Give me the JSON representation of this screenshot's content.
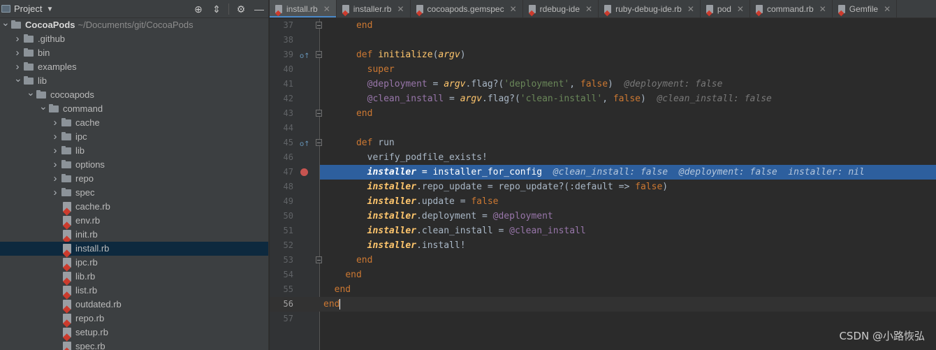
{
  "project_panel": {
    "title": "Project",
    "tree": [
      {
        "name": "CocoaPods",
        "path": "~/Documents/git/CocoaPods",
        "kind": "root",
        "expanded": true,
        "depth": 0
      },
      {
        "name": ".github",
        "kind": "folder",
        "expanded": false,
        "depth": 1
      },
      {
        "name": "bin",
        "kind": "folder",
        "expanded": false,
        "depth": 1
      },
      {
        "name": "examples",
        "kind": "folder",
        "expanded": false,
        "depth": 1
      },
      {
        "name": "lib",
        "kind": "folder",
        "expanded": true,
        "depth": 1
      },
      {
        "name": "cocoapods",
        "kind": "folder",
        "expanded": true,
        "depth": 2
      },
      {
        "name": "command",
        "kind": "folder",
        "expanded": true,
        "depth": 3
      },
      {
        "name": "cache",
        "kind": "folder",
        "expanded": false,
        "depth": 4
      },
      {
        "name": "ipc",
        "kind": "folder",
        "expanded": false,
        "depth": 4
      },
      {
        "name": "lib",
        "kind": "folder",
        "expanded": false,
        "depth": 4
      },
      {
        "name": "options",
        "kind": "folder",
        "expanded": false,
        "depth": 4
      },
      {
        "name": "repo",
        "kind": "folder",
        "expanded": false,
        "depth": 4
      },
      {
        "name": "spec",
        "kind": "folder",
        "expanded": false,
        "depth": 4
      },
      {
        "name": "cache.rb",
        "kind": "ruby-file",
        "depth": 4
      },
      {
        "name": "env.rb",
        "kind": "ruby-file",
        "depth": 4
      },
      {
        "name": "init.rb",
        "kind": "ruby-file",
        "depth": 4
      },
      {
        "name": "install.rb",
        "kind": "ruby-file",
        "depth": 4,
        "selected": true
      },
      {
        "name": "ipc.rb",
        "kind": "ruby-file",
        "depth": 4
      },
      {
        "name": "lib.rb",
        "kind": "ruby-file",
        "depth": 4
      },
      {
        "name": "list.rb",
        "kind": "ruby-file",
        "depth": 4
      },
      {
        "name": "outdated.rb",
        "kind": "ruby-file",
        "depth": 4
      },
      {
        "name": "repo.rb",
        "kind": "ruby-file",
        "depth": 4
      },
      {
        "name": "setup.rb",
        "kind": "ruby-file",
        "depth": 4
      },
      {
        "name": "spec.rb",
        "kind": "ruby-file",
        "depth": 4
      }
    ]
  },
  "tabs": [
    {
      "label": "install.rb",
      "active": true,
      "icon": "ruby-file-icon"
    },
    {
      "label": "installer.rb",
      "active": false,
      "icon": "ruby-file-icon"
    },
    {
      "label": "cocoapods.gemspec",
      "active": false,
      "icon": "ruby-file-icon"
    },
    {
      "label": "rdebug-ide",
      "active": false,
      "icon": "ruby-file-icon"
    },
    {
      "label": "ruby-debug-ide.rb",
      "active": false,
      "icon": "ruby-file-icon"
    },
    {
      "label": "pod",
      "active": false,
      "icon": "ruby-file-icon"
    },
    {
      "label": "command.rb",
      "active": false,
      "icon": "ruby-file-icon"
    },
    {
      "label": "Gemfile",
      "active": false,
      "icon": "ruby-file-icon"
    }
  ],
  "editor": {
    "execution_line": 47,
    "current_line": 56,
    "breakpoint_lines": [
      47
    ],
    "override_marker_lines": [
      39,
      45
    ],
    "fold_marker_lines": [
      37,
      39,
      43,
      45,
      53
    ],
    "lines": [
      {
        "n": 37,
        "tokens": [
          {
            "t": "      "
          },
          {
            "t": "end",
            "c": "kw"
          }
        ]
      },
      {
        "n": 38,
        "tokens": []
      },
      {
        "n": 39,
        "tokens": [
          {
            "t": "      "
          },
          {
            "t": "def ",
            "c": "kw"
          },
          {
            "t": "initialize",
            "c": "fn"
          },
          {
            "t": "("
          },
          {
            "t": "argv",
            "c": "param"
          },
          {
            "t": ")"
          }
        ]
      },
      {
        "n": 40,
        "tokens": [
          {
            "t": "        "
          },
          {
            "t": "super",
            "c": "kw"
          }
        ]
      },
      {
        "n": 41,
        "tokens": [
          {
            "t": "        "
          },
          {
            "t": "@deployment",
            "c": "ivar"
          },
          {
            "t": " = "
          },
          {
            "t": "argv",
            "c": "param"
          },
          {
            "t": ".flag?("
          },
          {
            "t": "'deployment'",
            "c": "str"
          },
          {
            "t": ", "
          },
          {
            "t": "false",
            "c": "kw"
          },
          {
            "t": ")  "
          },
          {
            "t": "@deployment: false",
            "c": "hint"
          }
        ]
      },
      {
        "n": 42,
        "tokens": [
          {
            "t": "        "
          },
          {
            "t": "@clean_install",
            "c": "ivar"
          },
          {
            "t": " = "
          },
          {
            "t": "argv",
            "c": "param"
          },
          {
            "t": ".flag?("
          },
          {
            "t": "'clean-install'",
            "c": "str"
          },
          {
            "t": ", "
          },
          {
            "t": "false",
            "c": "kw"
          },
          {
            "t": ")  "
          },
          {
            "t": "@clean_install: false",
            "c": "hint"
          }
        ]
      },
      {
        "n": 43,
        "tokens": [
          {
            "t": "      "
          },
          {
            "t": "end",
            "c": "kw"
          }
        ]
      },
      {
        "n": 44,
        "tokens": []
      },
      {
        "n": 45,
        "tokens": [
          {
            "t": "      "
          },
          {
            "t": "def ",
            "c": "kw"
          },
          {
            "t": "run"
          }
        ]
      },
      {
        "n": 46,
        "tokens": [
          {
            "t": "        verify_podfile_exists!"
          }
        ]
      },
      {
        "n": 47,
        "tokens": [
          {
            "t": "        "
          },
          {
            "t": "installer",
            "c": "lvar"
          },
          {
            "t": " = installer_for_config  "
          },
          {
            "t": "@clean_install: false  @deployment: false  installer: nil",
            "c": "hint"
          }
        ]
      },
      {
        "n": 48,
        "tokens": [
          {
            "t": "        "
          },
          {
            "t": "installer",
            "c": "lvar"
          },
          {
            "t": ".repo_update = repo_update?(:default => "
          },
          {
            "t": "false",
            "c": "kw"
          },
          {
            "t": ")"
          }
        ]
      },
      {
        "n": 49,
        "tokens": [
          {
            "t": "        "
          },
          {
            "t": "installer",
            "c": "lvar"
          },
          {
            "t": ".update = "
          },
          {
            "t": "false",
            "c": "kw"
          }
        ]
      },
      {
        "n": 50,
        "tokens": [
          {
            "t": "        "
          },
          {
            "t": "installer",
            "c": "lvar"
          },
          {
            "t": ".deployment = "
          },
          {
            "t": "@deployment",
            "c": "ivar"
          }
        ]
      },
      {
        "n": 51,
        "tokens": [
          {
            "t": "        "
          },
          {
            "t": "installer",
            "c": "lvar"
          },
          {
            "t": ".clean_install = "
          },
          {
            "t": "@clean_install",
            "c": "ivar"
          }
        ]
      },
      {
        "n": 52,
        "tokens": [
          {
            "t": "        "
          },
          {
            "t": "installer",
            "c": "lvar"
          },
          {
            "t": ".install!"
          }
        ]
      },
      {
        "n": 53,
        "tokens": [
          {
            "t": "      "
          },
          {
            "t": "end",
            "c": "kw"
          }
        ]
      },
      {
        "n": 54,
        "tokens": [
          {
            "t": "    "
          },
          {
            "t": "end",
            "c": "kw"
          }
        ]
      },
      {
        "n": 55,
        "tokens": [
          {
            "t": "  "
          },
          {
            "t": "end",
            "c": "kw"
          }
        ]
      },
      {
        "n": 56,
        "tokens": [
          {
            "t": "end",
            "c": "kw"
          }
        ],
        "caret": true
      },
      {
        "n": 57,
        "tokens": []
      }
    ]
  },
  "watermark": "CSDN @小路恢弘",
  "colors": {
    "keyword": "#cc7832",
    "function": "#ffc66d",
    "instance_var": "#9876aa",
    "string": "#6a8759",
    "hint": "#787878",
    "execution_highlight": "#2d5f9e",
    "breakpoint": "#c75450",
    "selection": "#0d293e"
  }
}
